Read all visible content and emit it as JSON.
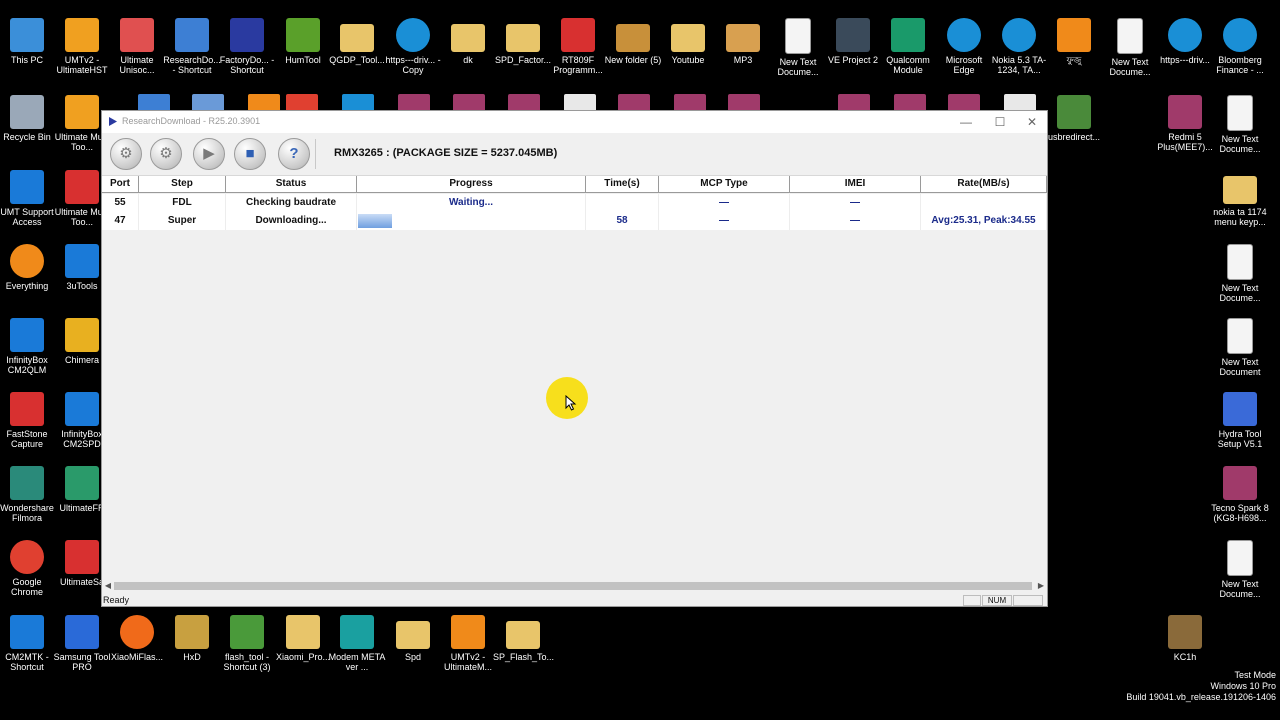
{
  "colors": {
    "desktop_bg": "#000000",
    "window_bg": "#f0f0f0",
    "progress_blue": "#6f9fe0",
    "highlight_yellow": "#f7df1c",
    "data_blue": "#1a2a8a"
  },
  "desktop_icons": [
    {
      "label": "This PC",
      "icon": "this-pc-icon",
      "color": "#3b8fd9"
    },
    {
      "label": "UMTv2 - UltimateHST",
      "icon": "umt-icon",
      "color": "#f0a020"
    },
    {
      "label": "Ultimate Unisoc...",
      "icon": "unisoc-icon",
      "color": "#e05050"
    },
    {
      "label": "ResearchDo... - Shortcut",
      "icon": "research-download-icon",
      "color": "#3d7fd4"
    },
    {
      "label": "FactoryDo... - Shortcut",
      "icon": "factory-download-icon",
      "color": "#2a3aa0"
    },
    {
      "label": "HumTool",
      "icon": "humtool-icon",
      "color": "#5aa02a"
    },
    {
      "label": "QGDP_Tool...",
      "icon": "folder-icon",
      "color": "#e8c56a"
    },
    {
      "label": "https---driv... - Copy",
      "icon": "edge-icon",
      "color": "#1a8fd6"
    },
    {
      "label": "dk",
      "icon": "folder-icon",
      "color": "#e8c56a"
    },
    {
      "label": "SPD_Factor...",
      "icon": "folder-icon",
      "color": "#e8c56a"
    },
    {
      "label": "RT809F Programm...",
      "icon": "pdf-icon",
      "color": "#d83030"
    },
    {
      "label": "New folder (5)",
      "icon": "folder-icon",
      "color": "#c8903a"
    },
    {
      "label": "Youtube",
      "icon": "folder-icon",
      "color": "#e8c56a"
    },
    {
      "label": "MP3",
      "icon": "folder-icon",
      "color": "#d8a050"
    },
    {
      "label": "New Text Docume...",
      "icon": "text-file-icon",
      "color": "#f4f4f4"
    },
    {
      "label": "VE Project 2",
      "icon": "ve-project-icon",
      "color": "#3a4a5a"
    },
    {
      "label": "Qualcomm Module",
      "icon": "qualcomm-icon",
      "color": "#1a9a6a"
    },
    {
      "label": "Microsoft Edge",
      "icon": "edge-icon",
      "color": "#1a8fd6"
    },
    {
      "label": "Nokia 5.3 TA-1234, TA...",
      "icon": "edge-icon",
      "color": "#1a8fd6"
    },
    {
      "label": "ফুজু",
      "icon": "vlc-icon",
      "color": "#f08a1a"
    },
    {
      "label": "New Text Docume...",
      "icon": "text-file-icon",
      "color": "#f4f4f4"
    },
    {
      "label": "https---driv...",
      "icon": "edge-icon",
      "color": "#1a8fd6"
    },
    {
      "label": "Bloomberg Finance - ...",
      "icon": "edge-icon",
      "color": "#1a8fd6"
    },
    {
      "label": "Recycle Bin",
      "icon": "recycle-bin-icon",
      "color": "#9aa8b8"
    },
    {
      "label": "Ultimate Multi Too...",
      "icon": "umt-icon",
      "color": "#f0a020"
    },
    {
      "label": "usbredirect...",
      "icon": "usb-icon",
      "color": "#4a8a3a"
    },
    {
      "label": "Redmi 5 Plus(MEE7)...",
      "icon": "winrar-icon",
      "color": "#a03a6a"
    },
    {
      "label": "New Text Docume...",
      "icon": "text-file-icon",
      "color": "#f4f4f4"
    },
    {
      "label": "UMT Support Access",
      "icon": "umt-support-icon",
      "color": "#1a7ad8"
    },
    {
      "label": "Ultimate Multi Too...",
      "icon": "umt-icon",
      "color": "#d83030"
    },
    {
      "label": "nokia ta 1174 menu keyp...",
      "icon": "folder-icon",
      "color": "#e8c56a"
    },
    {
      "label": "Everything",
      "icon": "everything-icon",
      "color": "#f08a1a"
    },
    {
      "label": "3uTools",
      "icon": "3utools-icon",
      "color": "#1a7ad8"
    },
    {
      "label": "New Text Docume...",
      "icon": "text-file-icon",
      "color": "#f4f4f4"
    },
    {
      "label": "InfinityBox CM2QLM",
      "icon": "infinitybox-icon",
      "color": "#1a7ad8"
    },
    {
      "label": "Chimera",
      "icon": "chimera-icon",
      "color": "#e8b020"
    },
    {
      "label": "New Text Document",
      "icon": "text-file-icon",
      "color": "#f4f4f4"
    },
    {
      "label": "FastStone Capture",
      "icon": "faststone-icon",
      "color": "#d83030"
    },
    {
      "label": "InfinityBox CM2SPD",
      "icon": "infinitybox-icon",
      "color": "#1a7ad8"
    },
    {
      "label": "Hydra Tool Setup V5.1",
      "icon": "hydra-icon",
      "color": "#3a6ad8"
    },
    {
      "label": "Wondershare Filmora",
      "icon": "filmora-icon",
      "color": "#2a8a7a"
    },
    {
      "label": "UltimateFR",
      "icon": "ultimate-frp-icon",
      "color": "#2a9a6a"
    },
    {
      "label": "Tecno Spark 8 (KG8-H698...",
      "icon": "winrar-icon",
      "color": "#a03a6a"
    },
    {
      "label": "Google Chrome",
      "icon": "chrome-icon",
      "color": "#e04030"
    },
    {
      "label": "UltimateSa",
      "icon": "ultimate-samsung-icon",
      "color": "#d83030"
    },
    {
      "label": "New Text Docume...",
      "icon": "text-file-icon",
      "color": "#f4f4f4"
    },
    {
      "label": "CM2MTK - Shortcut",
      "icon": "infinitybox-icon",
      "color": "#1a7ad8"
    },
    {
      "label": "Samsung Tool PRO",
      "icon": "samsung-tool-icon",
      "color": "#2a6ad8"
    },
    {
      "label": "XiaoMiFlas...",
      "icon": "xiaomi-icon",
      "color": "#f06a1a"
    },
    {
      "label": "HxD",
      "icon": "hxd-icon",
      "color": "#c8a040"
    },
    {
      "label": "flash_tool - Shortcut (3)",
      "icon": "flash-tool-icon",
      "color": "#4a9a3a"
    },
    {
      "label": "Xiaomi_Pro...",
      "icon": "xiaomi-pro-icon",
      "color": "#e8c56a"
    },
    {
      "label": "Modem META ver ...",
      "icon": "modem-meta-icon",
      "color": "#1aa0a0"
    },
    {
      "label": "Spd",
      "icon": "folder-icon",
      "color": "#e8c56a"
    },
    {
      "label": "UMTv2 - UltimateM...",
      "icon": "umt-icon",
      "color": "#f08a1a"
    },
    {
      "label": "SP_Flash_To...",
      "icon": "folder-icon",
      "color": "#e8c56a"
    },
    {
      "label": "KC1h",
      "icon": "winrar-icon",
      "color": "#8a6a3a"
    }
  ],
  "window": {
    "title": "ResearchDownload - R25.20.3901",
    "minimize": "—",
    "maximize": "☐",
    "close": "✕",
    "toolbar": {
      "load_packet_icon": "gear-icon",
      "settings_icon": "settings-icon",
      "start_icon": "play-icon",
      "stop_icon": "stop-icon",
      "help_icon": "help-icon",
      "help_label": "?"
    },
    "package_info": "RMX3265 :  (PACKAGE SIZE = 5237.045MB)",
    "columns": [
      "Port",
      "Step",
      "Status",
      "Progress",
      "Time(s)",
      "MCP Type",
      "IMEI",
      "Rate(MB/s)"
    ],
    "rows": [
      {
        "port": "55",
        "step": "FDL",
        "status": "Checking baudrate",
        "progress_text": "Waiting...",
        "progress": 0,
        "time": "",
        "mcp": "—",
        "imei": "—",
        "rate": ""
      },
      {
        "port": "47",
        "step": "Super",
        "status": "Downloading...",
        "progress_text": "",
        "progress": 0.15,
        "time": "58",
        "mcp": "—",
        "imei": "—",
        "rate": "Avg:25.31, Peak:34.55"
      }
    ],
    "status_left": "Ready",
    "status_num": "NUM"
  },
  "watermark": {
    "line1": "Test Mode",
    "line2": "Windows 10 Pro",
    "line3": "Build 19041.vb_release.191206-1406"
  }
}
